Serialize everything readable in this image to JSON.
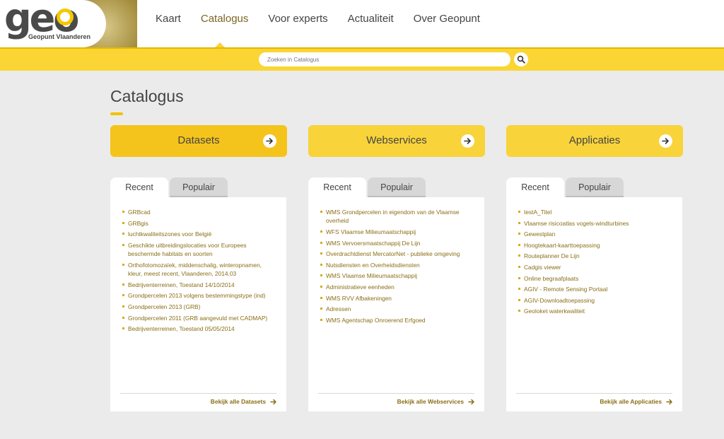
{
  "logo": {
    "text": "geo",
    "subtitle": "Geopunt Vlaanderen"
  },
  "nav": {
    "items": [
      {
        "label": "Kaart"
      },
      {
        "label": "Catalogus"
      },
      {
        "label": "Voor experts"
      },
      {
        "label": "Actualiteit"
      },
      {
        "label": "Over Geopunt"
      }
    ],
    "active": "Catalogus"
  },
  "search": {
    "placeholder": "Zoeken in Catalogus",
    "icon": "search-icon"
  },
  "page": {
    "title": "Catalogus"
  },
  "categories": [
    {
      "label": "Datasets",
      "icon": "arrow-right-icon"
    },
    {
      "label": "Webservices",
      "icon": "arrow-right-icon"
    },
    {
      "label": "Applicaties",
      "icon": "arrow-right-icon"
    }
  ],
  "panels": [
    {
      "tabs": {
        "recent": "Recent",
        "popular": "Populair"
      },
      "active_tab": "Recent",
      "items": [
        "GRBcad",
        "GRBgis",
        "luchtkwaliteitszones voor België",
        "Geschikte uitbreidingslocaties voor Europees beschermde habitats en soorten",
        "Orthofotomozaïek, middenschalig, winteropnamen, kleur, meest recent, Vlaanderen, 2014.03",
        "Bedrijventerreinen, Toestand 14/10/2014",
        "Grondpercelen 2013 volgens bestemmingstype (ind)",
        "Grondpercelen 2013 (GRB)",
        "Grondpercelen 2011 (GRB aangevuld met CADMAP)",
        "Bedrijventerreinen, Toestand 05/05/2014"
      ],
      "link": "Bekijk alle Datasets"
    },
    {
      "tabs": {
        "recent": "Recent",
        "popular": "Populair"
      },
      "active_tab": "Recent",
      "items": [
        "WMS Grondpercelen in eigendom van de Vlaamse overheid",
        "WFS Vlaamse Milieumaatschappij",
        "WMS Vervoersmaatschappij De Lijn",
        "Overdrachtdienst MercatorNet - publieke omgeving",
        "Nutsdiensten en Overheidsdiensten",
        "WMS Vlaamse Milieumaatschappij",
        "Administratieve eenheden",
        "WMS RVV Afbakeningen",
        "Adressen",
        "WMS Agentschap Onroerend Erfgoed"
      ],
      "link": "Bekijk alle Webservices"
    },
    {
      "tabs": {
        "recent": "Recent",
        "popular": "Populair"
      },
      "active_tab": "Recent",
      "items": [
        "testA_Titel",
        "Vlaamse risicoatlas vogels-windturbines",
        "Gewestplan",
        "Hoogtekaart-kaarttoepassing",
        "Routeplanner De Lijn",
        "Cadgis viewer",
        "Online begraafplaats",
        "AGIV - Remote Sensing Portaal",
        "AGIV-Downloadtoepassing",
        "Geoloket waterkwaliteit"
      ],
      "link": "Bekijk alle Applicaties"
    }
  ],
  "colors": {
    "accent": "#f8d33a",
    "link": "#8a6f17",
    "background": "#ebebeb"
  }
}
